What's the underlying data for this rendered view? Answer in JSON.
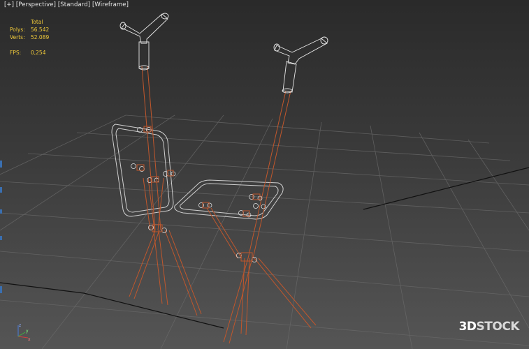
{
  "viewport": {
    "labels": [
      "[+]",
      "[Perspective]",
      "[Standard]",
      "[Wireframe]"
    ]
  },
  "stats": {
    "header": "Total",
    "polys_label": "Polys:",
    "polys_value": "56.542",
    "verts_label": "Verts:",
    "verts_value": "52.089",
    "fps_label": "FPS:",
    "fps_value": "0,254"
  },
  "watermark": {
    "prefix": "3D",
    "text": "STOCK"
  },
  "gizmo": {
    "x_label": "x",
    "y_label": "y",
    "z_label": "z"
  },
  "colors": {
    "wire_orange": "#c1572c",
    "wire_white": "#e8e8e8",
    "grid": "#6b6b6b",
    "stats_text": "#f0c93a"
  }
}
